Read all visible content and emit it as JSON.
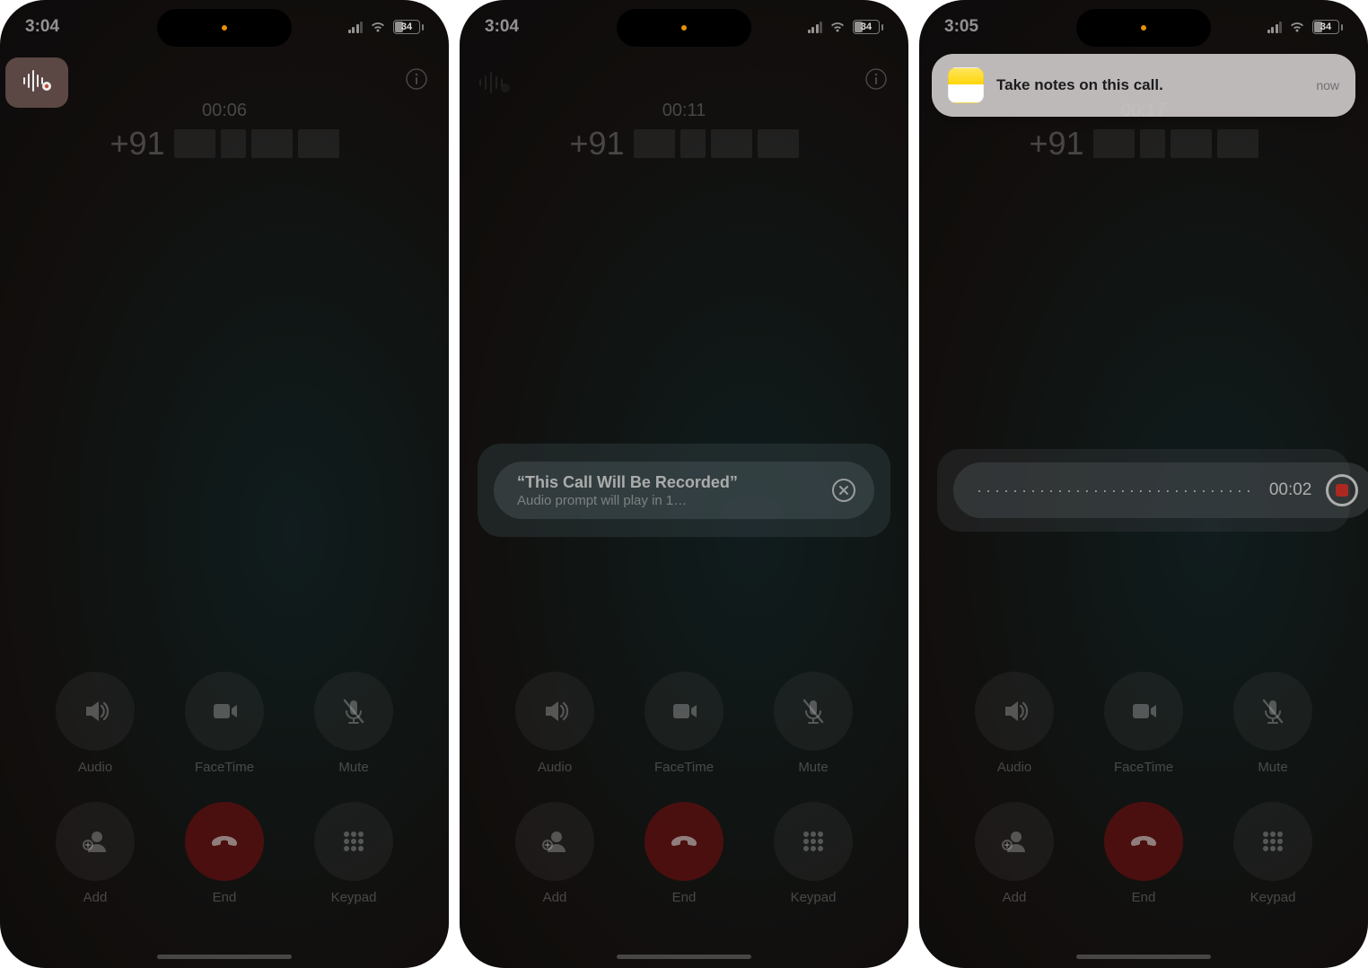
{
  "status_bar": {
    "battery_level": "34"
  },
  "screens": [
    {
      "time": "3:04",
      "call_timer": "00:06",
      "country_code": "+91"
    },
    {
      "time": "3:04",
      "call_timer": "00:11",
      "country_code": "+91",
      "popup": {
        "title": "“This Call Will Be Recorded”",
        "subtitle": "Audio prompt will play in 1…"
      }
    },
    {
      "time": "3:05",
      "call_timer": "00:17",
      "country_code": "+91",
      "rec_timer": "00:02",
      "notification": {
        "text": "Take notes on this call.",
        "time": "now"
      }
    }
  ],
  "call_buttons": {
    "audio": "Audio",
    "facetime": "FaceTime",
    "mute": "Mute",
    "add": "Add",
    "end": "End",
    "keypad": "Keypad"
  },
  "wave_dots": "·······························"
}
